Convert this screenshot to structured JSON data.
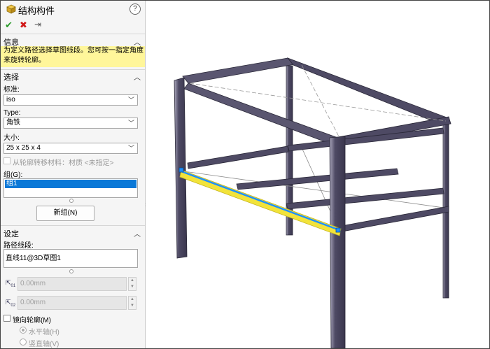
{
  "panel": {
    "title": "结构构件",
    "help_glyph": "?",
    "toolbar": {
      "ok_glyph": "✔",
      "cancel_glyph": "✖",
      "pin_glyph": "⇥"
    },
    "info": {
      "title": "信息",
      "text": "为定义路径选择草图线段。您可按一指定角度来旋转轮廓。"
    },
    "selection": {
      "title": "选择",
      "standard_label": "标准:",
      "standard_value": "iso",
      "type_label": "Type:",
      "type_value": "角铁",
      "size_label": "大小:",
      "size_value": "25 x 25 x 4",
      "transfer_material_label": "从轮廓转移材料：材质 <未指定>",
      "group_label": "组(G):",
      "groups": [
        "组1"
      ],
      "new_group_button": "新组(N)"
    },
    "settings": {
      "title": "设定",
      "path_label": "路径线段:",
      "path_value": "直线11@3D草图1",
      "offset1_value": "0.00mm",
      "offset2_value": "0.00mm",
      "mirror_label": "镜向轮廓(M)",
      "horizontal_axis_label": "水平轴(H)",
      "vertical_axis_label": "竖直轴(V)"
    }
  },
  "colors": {
    "frame_steel": "#4e4a64",
    "frame_edge": "#a9a6bb",
    "selected_member": "#f2e33a",
    "selected_path": "#1e90ff",
    "info_background": "#fff69a",
    "list_selection": "#0a78d7"
  },
  "icons": [
    "structure-cube-icon",
    "help-icon",
    "check-icon",
    "close-icon",
    "pin-icon",
    "chevron-up-icon",
    "chevron-down-icon",
    "offset-icon"
  ]
}
